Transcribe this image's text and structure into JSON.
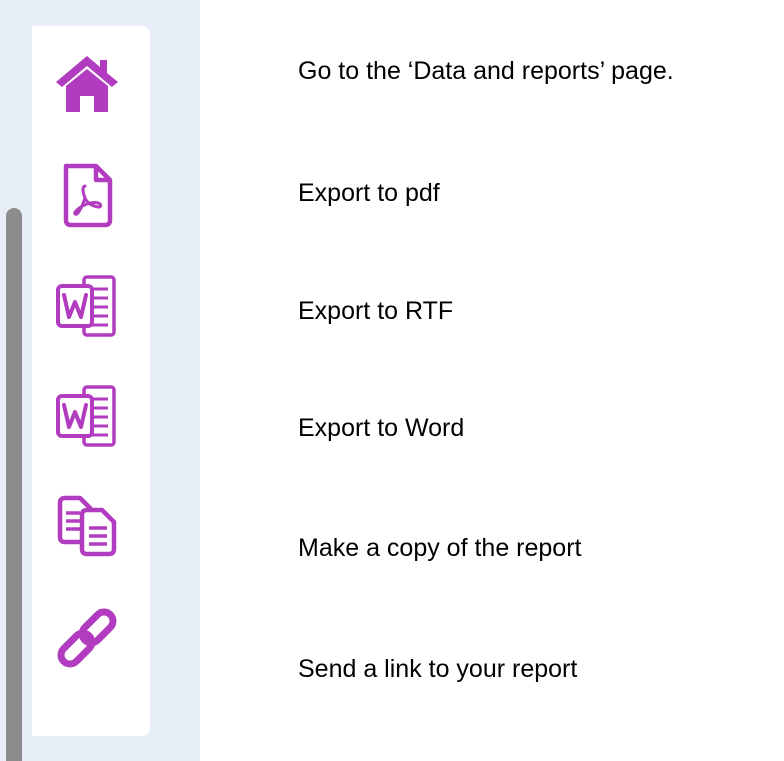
{
  "colors": {
    "icon": "#b23cbf",
    "panel_background": "#e8eef8",
    "scrollbar_thumb": "#8c8c8c"
  },
  "toolbar": {
    "items": [
      {
        "icon": "home-icon",
        "description": "Go to the ‘Data and reports’ page."
      },
      {
        "icon": "pdf-icon",
        "description": "Export to pdf"
      },
      {
        "icon": "word-icon",
        "description": "Export to RTF"
      },
      {
        "icon": "word-icon",
        "description": "Export to Word"
      },
      {
        "icon": "copy-icon",
        "description": "Make a copy of the report"
      },
      {
        "icon": "link-icon",
        "description": "Send a link to your report"
      }
    ]
  }
}
